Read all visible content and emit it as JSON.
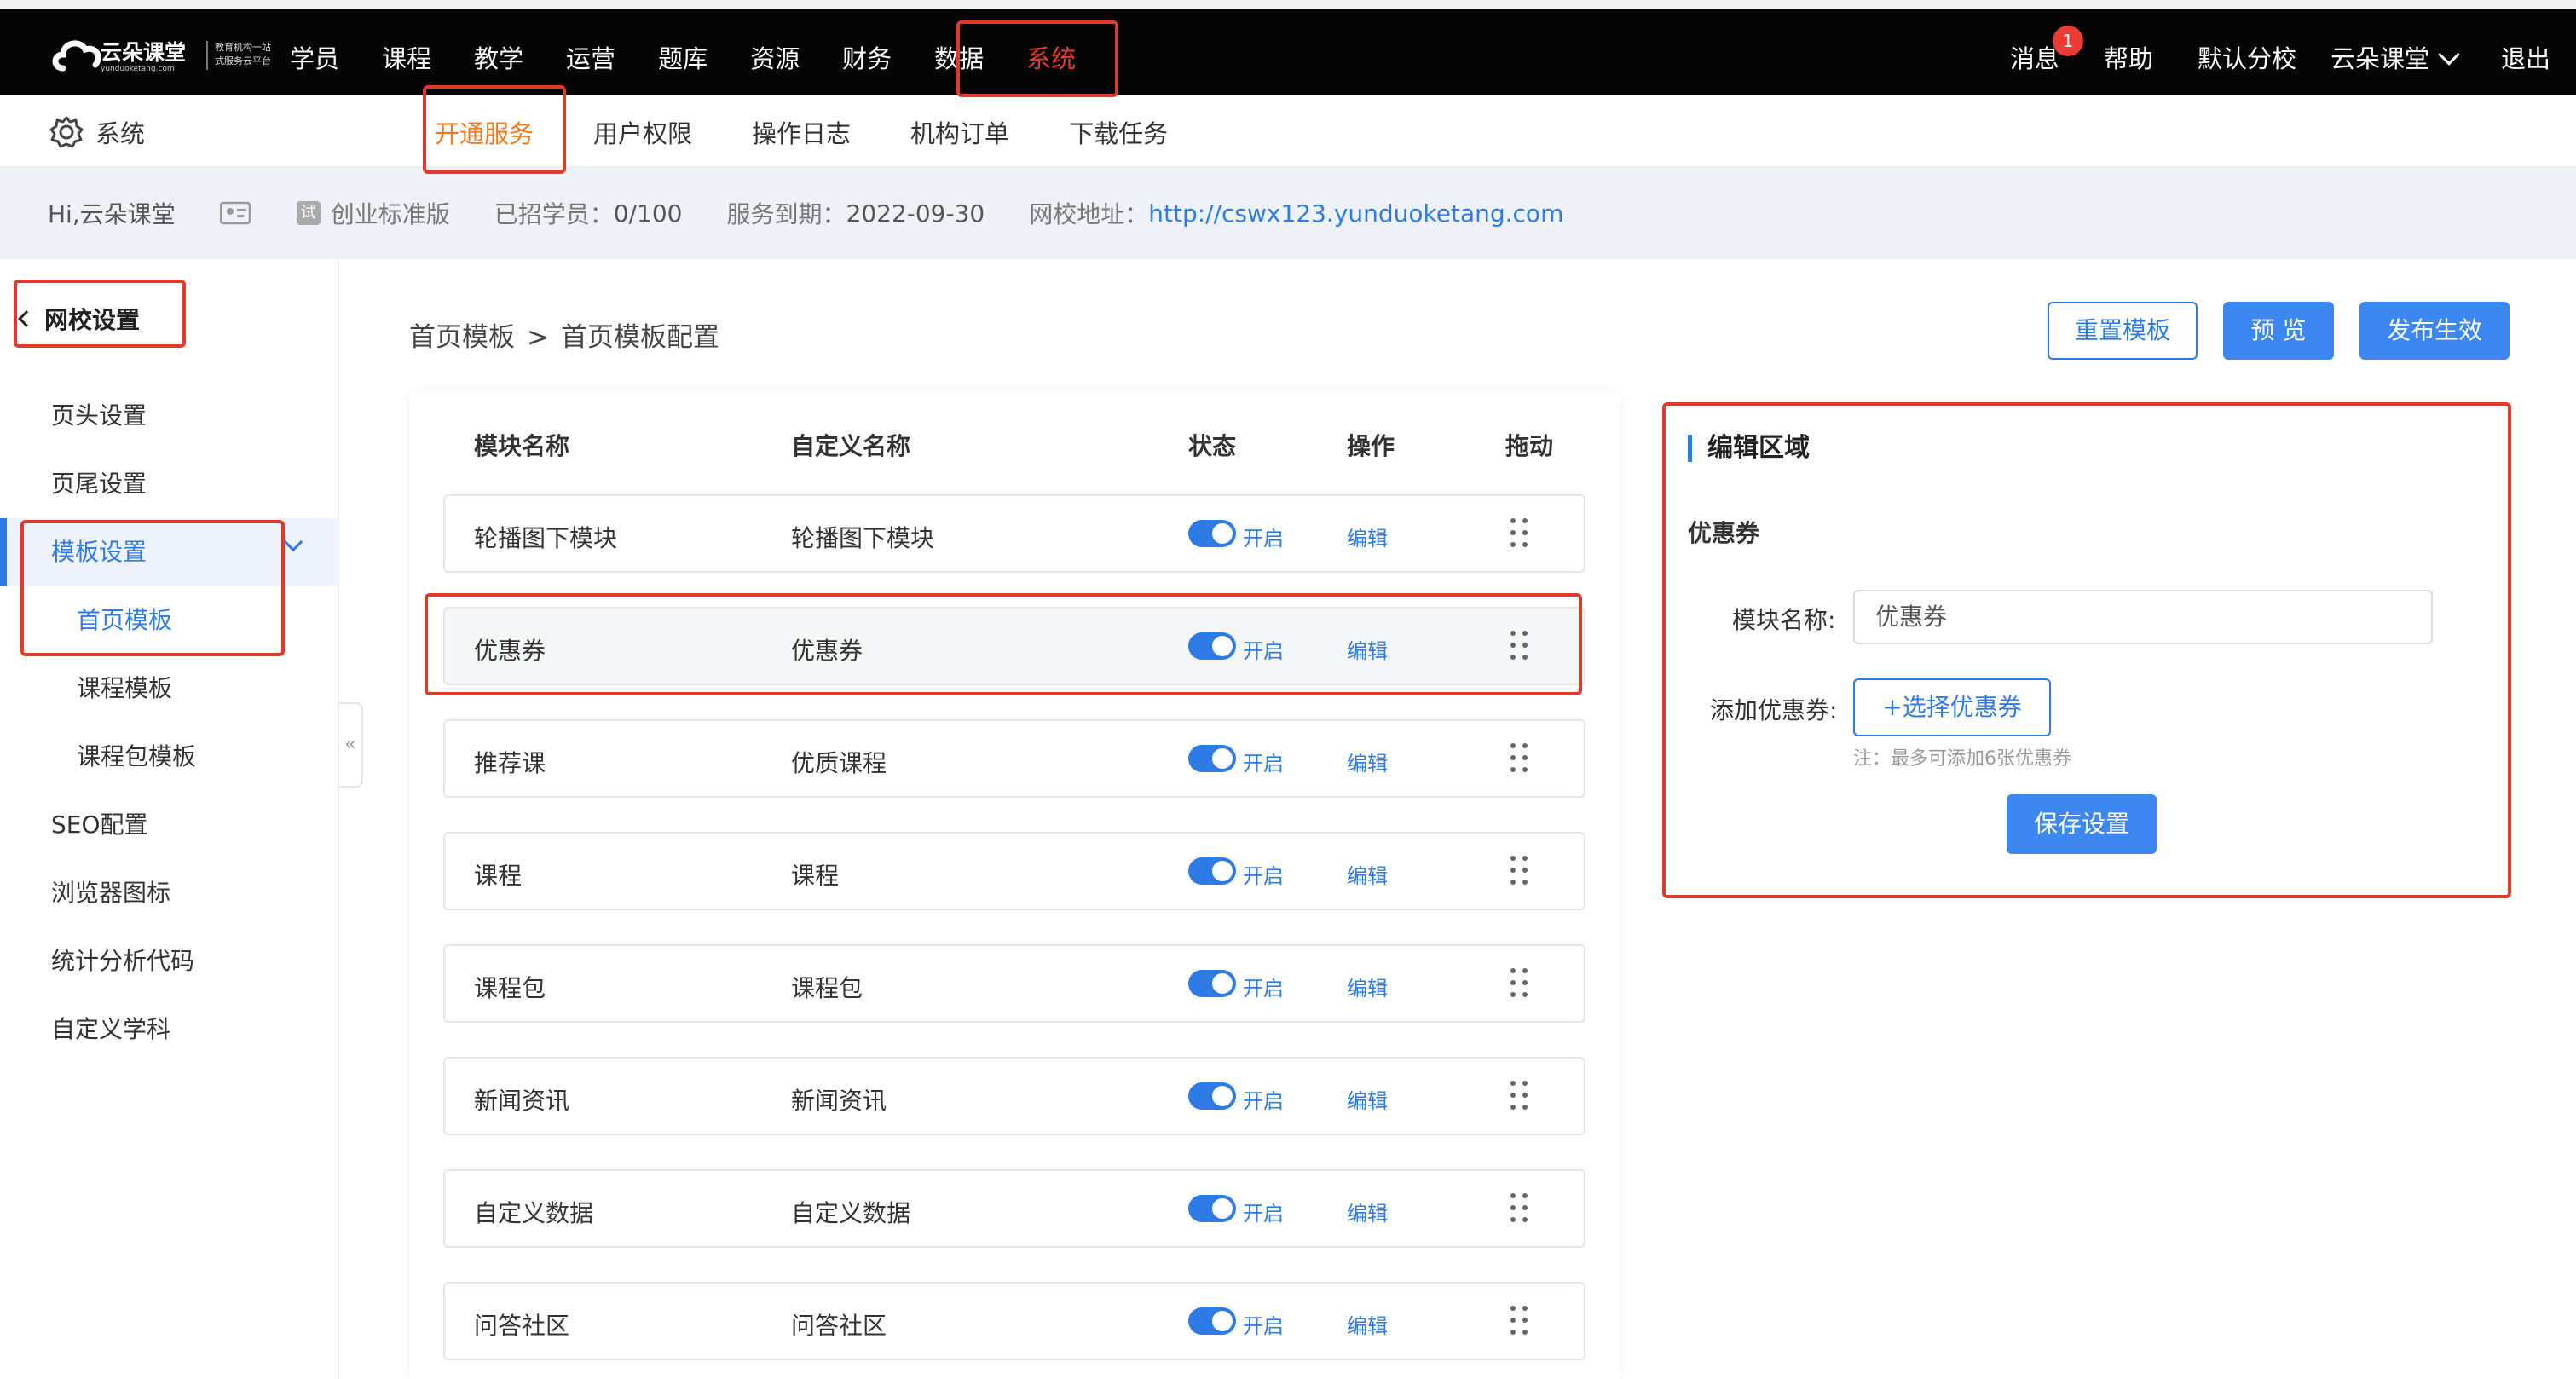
{
  "brand": {
    "name": "云朵课堂",
    "domain": "yunduoketang.com",
    "slogan_line1": "教育机构一站",
    "slogan_line2": "式服务云平台"
  },
  "top_menu": [
    "学员",
    "课程",
    "教学",
    "运营",
    "题库",
    "资源",
    "财务",
    "数据",
    "系统"
  ],
  "top_right": {
    "messages": "消息",
    "message_count": "1",
    "help": "帮助",
    "default_branch": "默认分校",
    "school_name": "云朵课堂",
    "logout": "退出"
  },
  "sub_nav": {
    "section_title": "系统",
    "tabs": [
      "开通服务",
      "用户权限",
      "操作日志",
      "机构订单",
      "下载任务"
    ]
  },
  "info_bar": {
    "greeting": "Hi,云朵课堂",
    "trial_tag": "试",
    "edition": "创业标准版",
    "students_label": "已招学员：",
    "students_value": "0/100",
    "expiry_label": "服务到期：",
    "expiry_value": "2022-09-30",
    "url_label": "网校地址：",
    "url_value": "http://cswx123.yunduoketang.com"
  },
  "sidebar": {
    "back_label": "网校设置",
    "items": [
      "页头设置",
      "页尾设置",
      "模板设置",
      "首页模板",
      "课程模板",
      "课程包模板",
      "SEO配置",
      "浏览器图标",
      "统计分析代码",
      "自定义学科"
    ],
    "collapse_glyph": "«"
  },
  "breadcrumb": {
    "parent": "首页模板",
    "separator": ">",
    "current": "首页模板配置"
  },
  "actions": {
    "reset": "重置模板",
    "preview": "预 览",
    "publish": "发布生效"
  },
  "table": {
    "headers": [
      "模块名称",
      "自定义名称",
      "状态",
      "操作",
      "拖动"
    ],
    "rows": [
      {
        "module": "轮播图下模块",
        "custom": "轮播图下模块",
        "status": "开启",
        "action": "编辑",
        "enabled": true
      },
      {
        "module": "优惠券",
        "custom": "优惠券",
        "status": "开启",
        "action": "编辑",
        "enabled": true
      },
      {
        "module": "推荐课",
        "custom": "优质课程",
        "status": "开启",
        "action": "编辑",
        "enabled": true
      },
      {
        "module": "课程",
        "custom": "课程",
        "status": "开启",
        "action": "编辑",
        "enabled": true
      },
      {
        "module": "课程包",
        "custom": "课程包",
        "status": "开启",
        "action": "编辑",
        "enabled": true
      },
      {
        "module": "新闻资讯",
        "custom": "新闻资讯",
        "status": "开启",
        "action": "编辑",
        "enabled": true
      },
      {
        "module": "自定义数据",
        "custom": "自定义数据",
        "status": "开启",
        "action": "编辑",
        "enabled": true
      },
      {
        "module": "问答社区",
        "custom": "问答社区",
        "status": "开启",
        "action": "编辑",
        "enabled": true
      }
    ]
  },
  "edit_panel": {
    "title": "编辑区域",
    "subtitle": "优惠券",
    "module_name_label": "模块名称:",
    "module_name_value": "优惠券",
    "add_coupon_label": "添加优惠券:",
    "select_coupon_button": "+选择优惠券",
    "note": "注：最多可添加6张优惠券",
    "save_button": "保存设置"
  },
  "colors": {
    "accent": "#2e7be6",
    "primary_button": "#3d87f0",
    "highlight_red": "#e03a2a",
    "active_tab_orange": "#f07a1f",
    "topbar": "#050505"
  }
}
